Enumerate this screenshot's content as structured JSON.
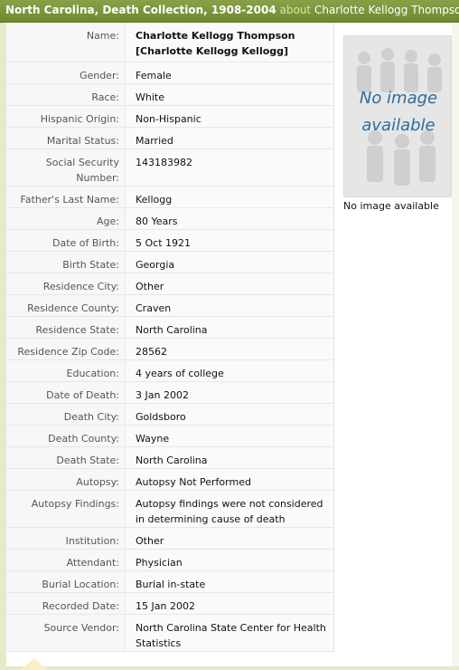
{
  "header": {
    "collection": "North Carolina, Death Collection, 1908-2004",
    "about_word": "about",
    "subject": "Charlotte Kellogg Thompson"
  },
  "image": {
    "placeholder_text": "No image available",
    "caption": "No image available"
  },
  "record": {
    "name": {
      "label": "Name:",
      "line1": "Charlotte Kellogg Thompson",
      "line2": "[Charlotte Kellogg Kellogg]"
    },
    "fields": [
      {
        "label": "Gender:",
        "value": "Female"
      },
      {
        "label": "Race:",
        "value": "White"
      },
      {
        "label": "Hispanic Origin:",
        "value": "Non-Hispanic"
      },
      {
        "label": "Marital Status:",
        "value": "Married"
      },
      {
        "label": "Social Security Number:",
        "value": "143183982"
      },
      {
        "label": "Father's Last Name:",
        "value": "Kellogg"
      },
      {
        "label": "Age:",
        "value": "80 Years"
      },
      {
        "label": "Date of Birth:",
        "value": "5 Oct 1921"
      },
      {
        "label": "Birth State:",
        "value": "Georgia"
      },
      {
        "label": "Residence City:",
        "value": "Other"
      },
      {
        "label": "Residence County:",
        "value": "Craven"
      },
      {
        "label": "Residence State:",
        "value": "North Carolina"
      },
      {
        "label": "Residence Zip Code:",
        "value": "28562"
      },
      {
        "label": "Education:",
        "value": "4 years of college"
      },
      {
        "label": "Date of Death:",
        "value": "3 Jan 2002"
      },
      {
        "label": "Death City:",
        "value": "Goldsboro"
      },
      {
        "label": "Death County:",
        "value": "Wayne"
      },
      {
        "label": "Death State:",
        "value": "North Carolina"
      },
      {
        "label": "Autopsy:",
        "value": "Autopsy Not Performed"
      },
      {
        "label": "Autopsy Findings:",
        "value": "Autopsy findings were not considered in determining cause of death"
      },
      {
        "label": "Institution:",
        "value": "Other"
      },
      {
        "label": "Attendant:",
        "value": "Physician"
      },
      {
        "label": "Burial Location:",
        "value": "Burial in-state"
      },
      {
        "label": "Recorded Date:",
        "value": "15 Jan 2002"
      },
      {
        "label": "Source Vendor:",
        "value": "North Carolina State Center for Health Statistics"
      }
    ]
  }
}
